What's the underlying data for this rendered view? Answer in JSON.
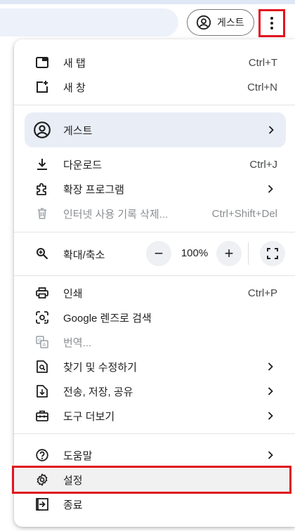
{
  "toolbar": {
    "profile_label": "게스트"
  },
  "menu": {
    "new_tab": {
      "label": "새 탭",
      "shortcut": "Ctrl+T"
    },
    "new_window": {
      "label": "새 창",
      "shortcut": "Ctrl+N"
    },
    "profile": {
      "label": "게스트"
    },
    "downloads": {
      "label": "다운로드",
      "shortcut": "Ctrl+J"
    },
    "extensions": {
      "label": "확장 프로그램"
    },
    "clear_history": {
      "label": "인터넷 사용 기록 삭제...",
      "shortcut": "Ctrl+Shift+Del"
    },
    "zoom": {
      "label": "확대/축소",
      "value": "100%",
      "minus": "−",
      "plus": "+"
    },
    "print": {
      "label": "인쇄",
      "shortcut": "Ctrl+P"
    },
    "google_lens": {
      "label": "Google 렌즈로 검색"
    },
    "translate": {
      "label": "번역..."
    },
    "find_edit": {
      "label": "찾기 및 수정하기"
    },
    "cast_save_share": {
      "label": "전송, 저장, 공유"
    },
    "more_tools": {
      "label": "도구 더보기"
    },
    "help": {
      "label": "도움말"
    },
    "settings": {
      "label": "설정"
    },
    "exit": {
      "label": "종료"
    }
  },
  "colors": {
    "highlight_border": "#e1141f",
    "profile_row_bg": "#e9eef6",
    "omnibox_bg": "#edf2fa"
  }
}
